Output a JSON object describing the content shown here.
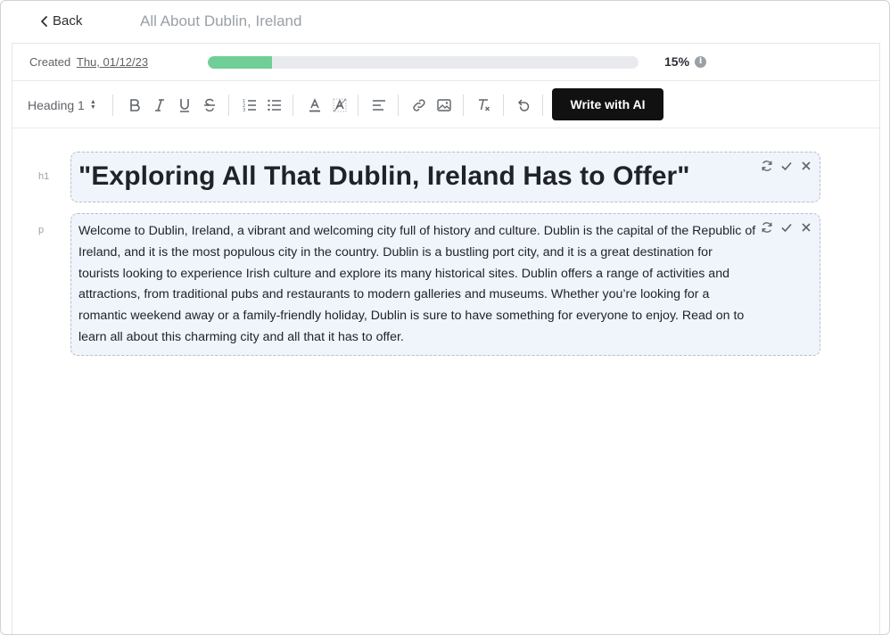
{
  "header": {
    "back_label": "Back",
    "document_title": "All About Dublin, Ireland"
  },
  "status": {
    "created_label": "Created",
    "created_date": "Thu, 01/12/23",
    "progress_percent": 15,
    "progress_label": "15%",
    "info_icon": "info-icon"
  },
  "toolbar": {
    "heading_select_value": "Heading 1",
    "icons": [
      "bold-icon",
      "italic-icon",
      "underline-icon",
      "strikethrough-icon",
      "ordered-list-icon",
      "bullet-list-icon",
      "text-color-icon",
      "highlight-icon",
      "align-icon",
      "link-icon",
      "image-icon",
      "clear-format-icon",
      "undo-icon"
    ],
    "ai_button_label": "Write with AI"
  },
  "blocks": [
    {
      "tag": "h1",
      "text": "\"Exploring All That Dublin, Ireland Has to Offer\""
    },
    {
      "tag": "p",
      "text": "Welcome to Dublin, Ireland, a vibrant and welcoming city full of history and culture. Dublin is the capital of the Republic of Ireland, and it is the most populous city in the country. Dublin is a bustling port city, and it is a great destination for tourists looking to experience Irish culture and explore its many historical sites. Dublin offers a range of activities and attractions, from traditional pubs and restaurants to modern galleries and museums. Whether you’re looking for a romantic weekend away or a family-friendly holiday, Dublin is sure to have something for everyone to enjoy. Read on to learn all about this charming city and all that it has to offer."
    }
  ],
  "colors": {
    "progress_fill": "#6fcf97",
    "block_bg": "#f0f4fb",
    "ai_button_bg": "#111111"
  }
}
